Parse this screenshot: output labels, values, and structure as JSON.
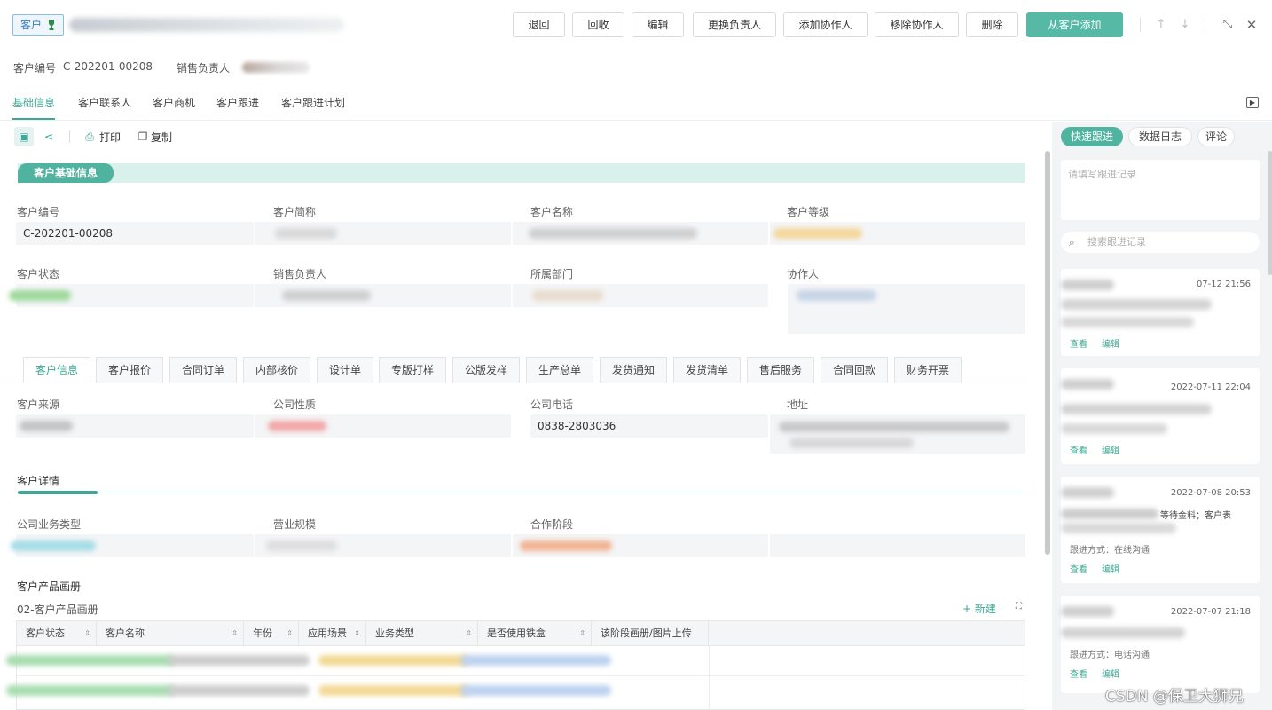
{
  "header": {
    "customer_tag": "客户",
    "buttons": {
      "back": "退回",
      "recycle": "回收",
      "edit": "编辑",
      "change_owner": "更换负责人",
      "add_collaborator": "添加协作人",
      "remove_collaborator": "移除协作人",
      "delete": "删除",
      "add_from_customer": "从客户添加"
    },
    "icons": [
      "arrow-up-icon",
      "arrow-down-icon",
      "shrink-icon",
      "close-icon"
    ]
  },
  "summary": {
    "code_label": "客户编号",
    "code_value": "C-202201-00208",
    "owner_label": "销售负责人"
  },
  "main_tabs": [
    "基础信息",
    "客户联系人",
    "客户商机",
    "客户跟进",
    "客户跟进计划"
  ],
  "toolbar": {
    "print": "打印",
    "copy": "复制"
  },
  "basic_section": {
    "title": "客户基础信息",
    "fields": {
      "code_label": "客户编号",
      "code_value": "C-202201-00208",
      "short_name_label": "客户简称",
      "name_label": "客户名称",
      "level_label": "客户等级",
      "status_label": "客户状态",
      "owner_label": "销售负责人",
      "dept_label": "所属部门",
      "collaborator_label": "协作人"
    }
  },
  "inner_tabs": [
    "客户信息",
    "客户报价",
    "合同订单",
    "内部核价",
    "设计单",
    "专版打样",
    "公版发样",
    "生产总单",
    "发货通知",
    "发货清单",
    "售后服务",
    "合同回款",
    "财务开票"
  ],
  "customer_info": {
    "source_label": "客户来源",
    "nature_label": "公司性质",
    "phone_label": "公司电话",
    "phone_value": "0838-2803036",
    "address_label": "地址"
  },
  "customer_detail": {
    "title": "客户详情",
    "business_type_label": "公司业务类型",
    "scale_label": "营业规模",
    "stage_label": "合作阶段"
  },
  "album": {
    "title": "客户产品画册",
    "subtitle": "02-客户产品画册",
    "new_label": "+ 新建",
    "columns": [
      "客户状态",
      "客户名称",
      "年份",
      "应用场景",
      "业务类型",
      "是否使用铁盒",
      "该阶段画册/图片上传"
    ]
  },
  "right_panel": {
    "tabs": [
      "快速跟进",
      "数据日志",
      "评论"
    ],
    "note_placeholder": "请填写跟进记录",
    "search_placeholder": "搜索跟进记录",
    "cards": [
      {
        "time": "07-12 21:56",
        "view": "查看",
        "edit": "编辑"
      },
      {
        "time": "2022-07-11 22:04",
        "view": "查看",
        "edit": "编辑"
      },
      {
        "time": "2022-07-08 20:53",
        "tail": "等待金料；客户表",
        "method": "跟进方式：在线沟通",
        "view": "查看",
        "edit": "编辑"
      },
      {
        "time": "2022-07-07 21:18",
        "method": "跟进方式：电话沟通",
        "view": "查看",
        "edit": "编辑"
      }
    ]
  },
  "watermark": "CSDN @保卫大狮兄",
  "colors": {
    "accent": "#3ea895",
    "accent_bg": "#d9f0eb",
    "primary_button": "#55b9a6"
  }
}
